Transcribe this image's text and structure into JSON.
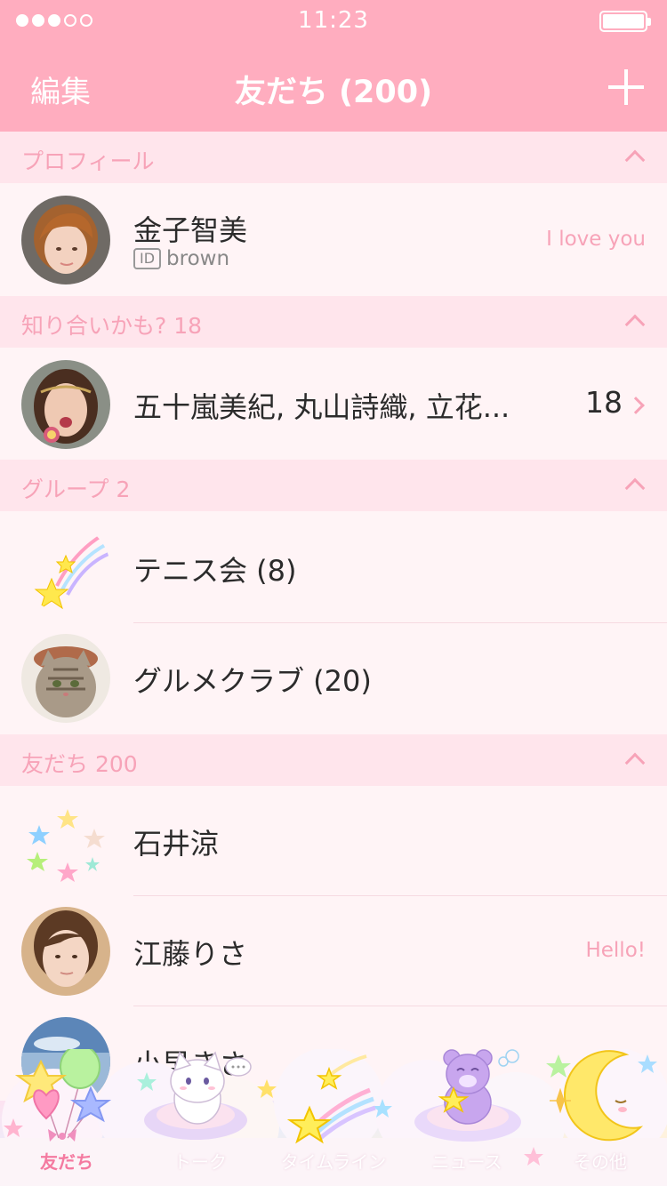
{
  "status_bar": {
    "time": "11:23",
    "signal_dots_filled": 3,
    "signal_dots_total": 5
  },
  "nav": {
    "edit_label": "編集",
    "title": "友だち (200)",
    "add_icon": "plus-icon"
  },
  "sections": {
    "profile": {
      "header": "プロフィール",
      "name": "金子智美",
      "id_badge": "ID",
      "id_value": "brown",
      "status_message": "I love you"
    },
    "suggested": {
      "header": "知り合いかも? 18",
      "names": "五十嵐美紀, 丸山詩織, 立花...",
      "count": "18"
    },
    "groups": {
      "header": "グループ 2",
      "items": [
        {
          "name": "テニス会 (8)"
        },
        {
          "name": "グルメクラブ (20)"
        }
      ]
    },
    "friends": {
      "header": "友だち 200",
      "items": [
        {
          "name": "石井涼",
          "status_message": ""
        },
        {
          "name": "江藤りさ",
          "status_message": "Hello!"
        },
        {
          "name": "小早きさ",
          "status_message": ""
        }
      ]
    }
  },
  "tabs": [
    {
      "label": "友だち",
      "icon": "balloons-icon",
      "active": true
    },
    {
      "label": "トーク",
      "icon": "cat-icon",
      "active": false
    },
    {
      "label": "タイムライン",
      "icon": "shooting-star-icon",
      "active": false
    },
    {
      "label": "ニュース",
      "icon": "bear-icon",
      "active": false
    },
    {
      "label": "その他",
      "icon": "moon-icon",
      "active": false
    }
  ],
  "colors": {
    "theme_pink": "#ffadbf",
    "section_bg": "#ffe5ec",
    "accent_text": "#f7a3b8",
    "row_bg": "#fff4f6"
  }
}
